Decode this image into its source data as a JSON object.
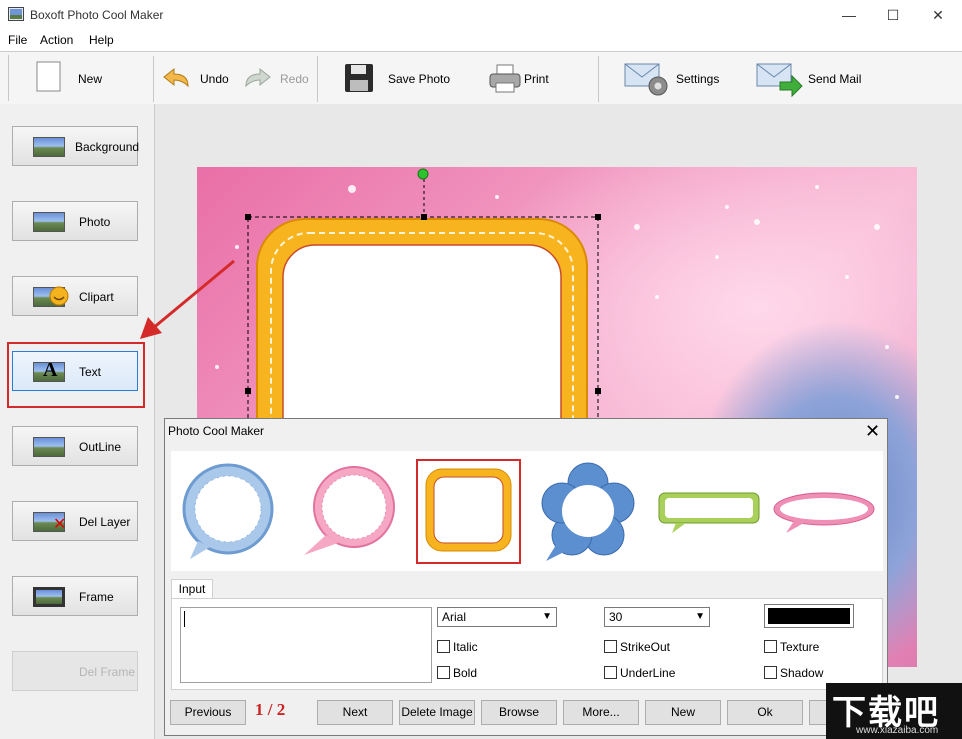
{
  "window": {
    "title": "Boxoft Photo Cool Maker",
    "minimize": "—",
    "maximize": "☐",
    "close": "✕"
  },
  "menu": [
    "File",
    "Action",
    "Help"
  ],
  "toolbar": {
    "new": "New",
    "undo": "Undo",
    "redo": "Redo",
    "save_photo": "Save Photo",
    "print": "Print",
    "settings": "Settings",
    "send_mail": "Send Mail"
  },
  "left_panel": [
    "Background",
    "Photo",
    "Clipart",
    "Text",
    "OutLine",
    "Del Layer",
    "Frame",
    "Del Frame"
  ],
  "dialog": {
    "title": "Photo Cool Maker",
    "close": "✕",
    "input_tab": "Input",
    "text_value": "",
    "font": "Arial",
    "size": "30",
    "checkboxes": {
      "italic": "Italic",
      "bold": "Bold",
      "strikeout": "StrikeOut",
      "underline": "UnderLine",
      "texture": "Texture",
      "shadow": "Shadow"
    },
    "pager": "1 / 2",
    "buttons": {
      "previous": "Previous",
      "next": "Next",
      "delete_image": "Delete Image",
      "browse": "Browse",
      "more": "More...",
      "new": "New",
      "ok": "Ok"
    }
  },
  "watermark": {
    "big": "下载吧",
    "small": "www.xiazaiba.com"
  },
  "colors": {
    "highlight": "#d42a2a",
    "selected_border": "#2b7bd8",
    "text_color": "#000000"
  }
}
